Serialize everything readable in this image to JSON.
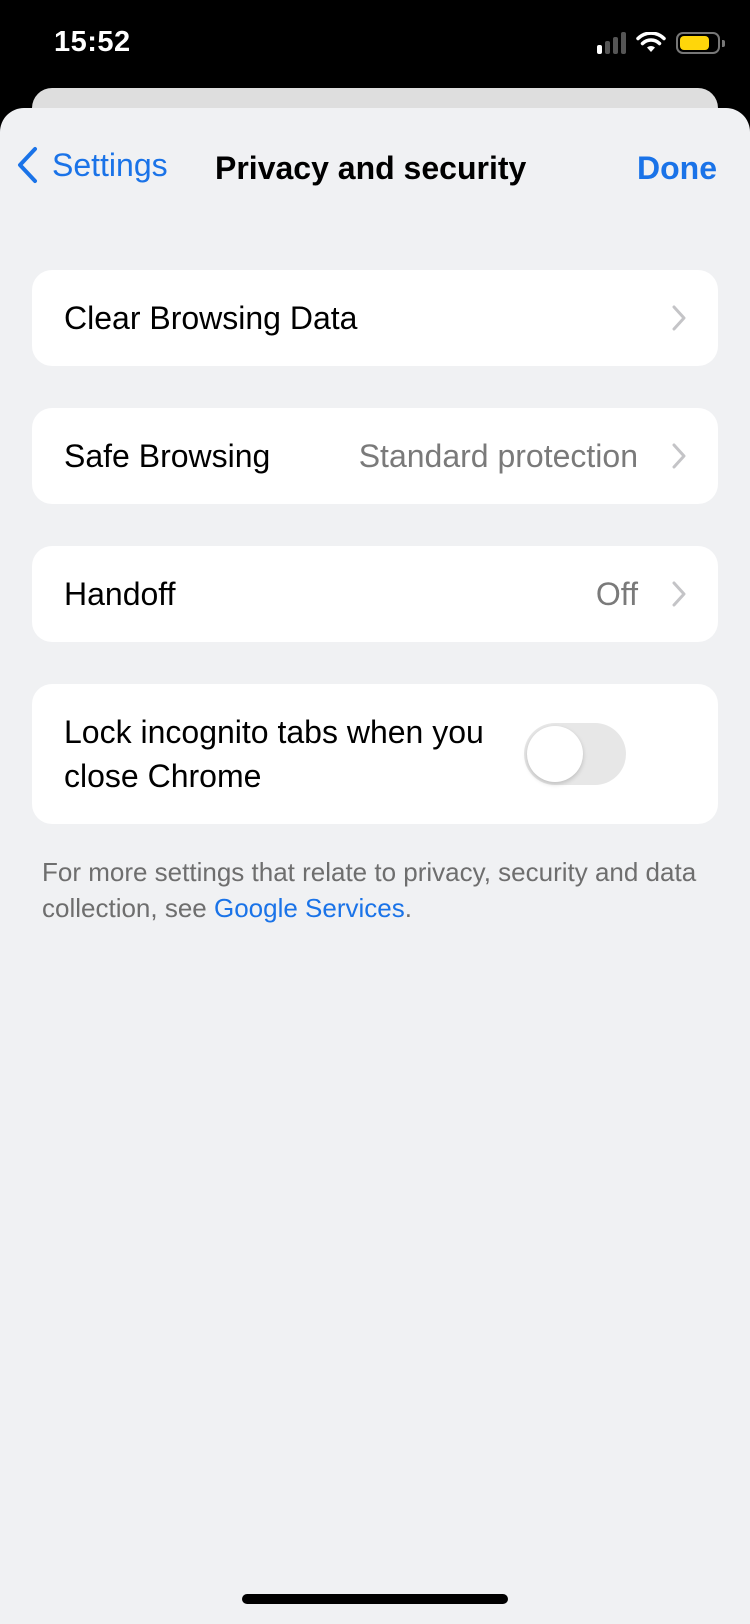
{
  "status_bar": {
    "time": "15:52",
    "icons": [
      "cellular-signal-icon",
      "wifi-icon",
      "battery-icon"
    ],
    "battery_color": "#ffd60a"
  },
  "nav": {
    "back_label": "Settings",
    "title": "Privacy and security",
    "done_label": "Done",
    "accent_color": "#1a73e8"
  },
  "items": [
    {
      "label": "Clear Browsing Data",
      "value": "",
      "control": "chevron"
    },
    {
      "label": "Safe Browsing",
      "value": "Standard protection",
      "control": "chevron"
    },
    {
      "label": "Handoff",
      "value": "Off",
      "control": "chevron"
    },
    {
      "label": "Lock incognito tabs when you close Chrome",
      "control": "toggle",
      "toggle_on": false
    }
  ],
  "footer": {
    "text": "For more settings that relate to privacy, security and data collection, see ",
    "link": "Google Services",
    "suffix": "."
  }
}
